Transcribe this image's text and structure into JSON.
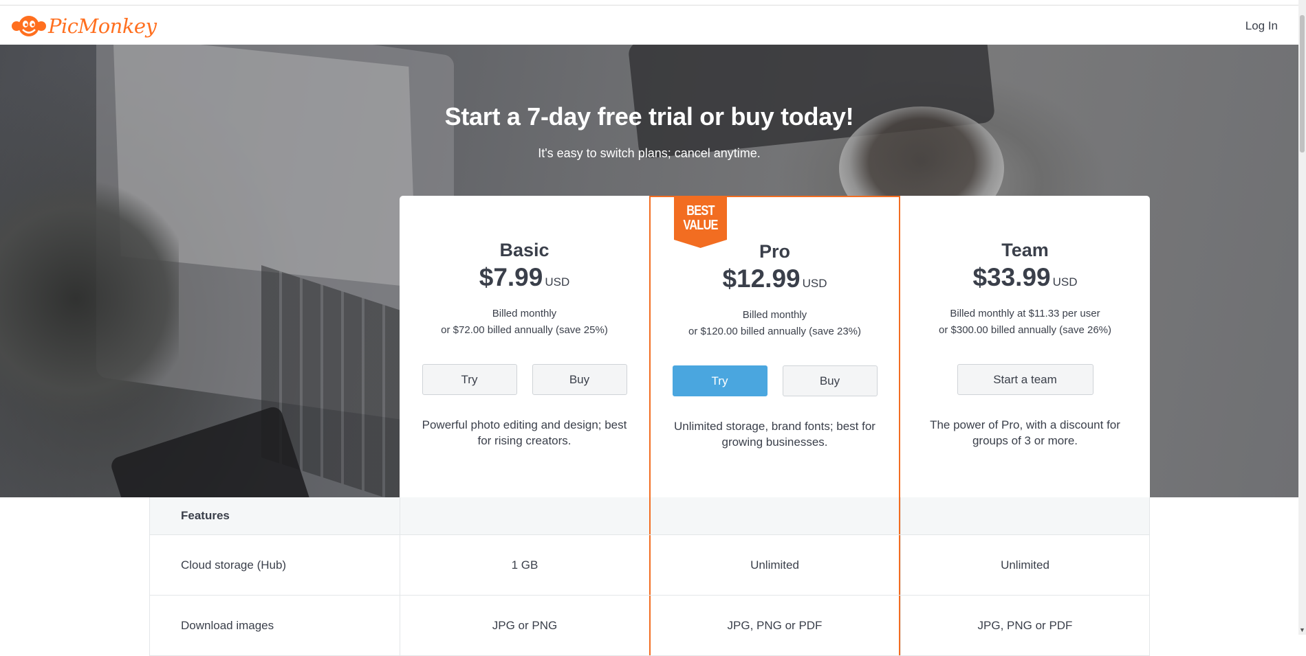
{
  "header": {
    "brand": "PicMonkey",
    "login_label": "Log In"
  },
  "hero": {
    "title": "Start a 7-day free trial or buy today!",
    "subtitle": "It's easy to switch plans; cancel anytime."
  },
  "plans": [
    {
      "name": "Basic",
      "price": "$7.99",
      "currency": "USD",
      "billing_line1": "Billed monthly",
      "billing_line2": "or $72.00 billed annually (save 25%)",
      "try_label": "Try",
      "buy_label": "Buy",
      "description": "Powerful photo editing and design; best for rising creators."
    },
    {
      "name": "Pro",
      "price": "$12.99",
      "currency": "USD",
      "billing_line1": "Billed monthly",
      "billing_line2": "or $120.00 billed annually (save 23%)",
      "try_label": "Try",
      "buy_label": "Buy",
      "badge_line1": "BEST",
      "badge_line2": "VALUE",
      "description": "Unlimited storage, brand fonts; best for growing businesses."
    },
    {
      "name": "Team",
      "price": "$33.99",
      "currency": "USD",
      "billing_line1": "Billed monthly at $11.33 per user",
      "billing_line2": "or $300.00 billed annually (save 26%)",
      "team_label": "Start a team",
      "description": "The power of Pro, with a discount for groups of 3 or more."
    }
  ],
  "features": {
    "header_label": "Features",
    "rows": [
      {
        "label": "Cloud storage (Hub)",
        "basic": "1 GB",
        "pro": "Unlimited",
        "team": "Unlimited"
      },
      {
        "label": "Download images",
        "basic": "JPG or PNG",
        "pro": "JPG, PNG or PDF",
        "team": "JPG, PNG or PDF"
      }
    ]
  },
  "colors": {
    "brand_orange": "#f26d21",
    "primary_blue": "#4aa6df",
    "text_dark": "#3a3f4a"
  },
  "icons": {
    "logo": "monkey-logo-icon",
    "scroll_down": "chevron-down-icon"
  }
}
